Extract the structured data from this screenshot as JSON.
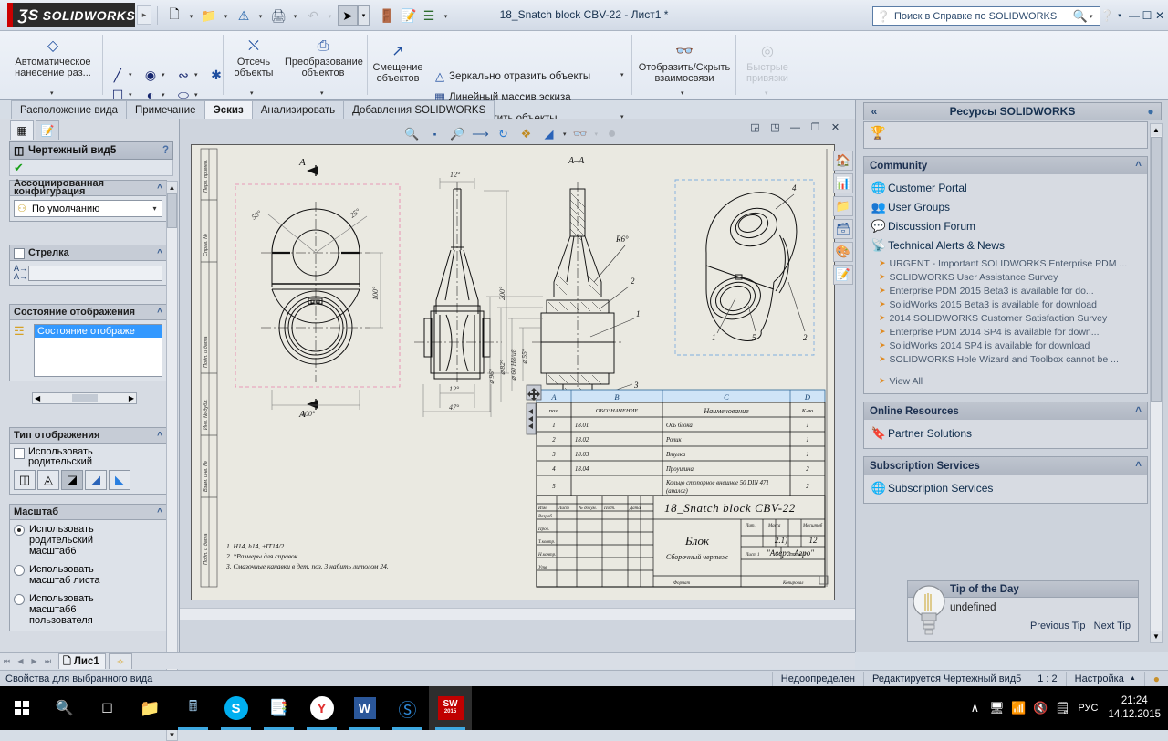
{
  "titlebar": {
    "logo_ds": "ƷS",
    "logo_text": "SOLIDWORKS",
    "document_title": "18_Snatch block CBV-22 - Лист1 *",
    "quick_access": [
      {
        "name": "new-document",
        "glyph": "🗋"
      },
      {
        "name": "open-document",
        "glyph": "📂"
      },
      {
        "name": "save-document",
        "glyph": "⚠"
      },
      {
        "name": "print-document",
        "glyph": "🖨"
      },
      {
        "name": "undo",
        "glyph": "↶"
      },
      {
        "name": "select",
        "glyph": "➤"
      },
      {
        "name": "rebuild",
        "glyph": "🚦"
      },
      {
        "name": "options-edit",
        "glyph": "📝"
      },
      {
        "name": "options",
        "glyph": "☰"
      }
    ],
    "help_search_placeholder": "Поиск в Справке по SOLIDWORKS",
    "window_buttons": [
      "❓",
      "➖",
      "❐",
      "✕"
    ]
  },
  "ribbon": {
    "auto_dimension": "Автоматическое\nнанесение раз...",
    "auto_dimension_l1": "Автоматическое",
    "auto_dimension_l2": "нанесение раз...",
    "trim_l1": "Отсечь",
    "trim_l2": "объекты",
    "convert_l1": "Преобразование",
    "convert_l2": "объектов",
    "offset_l1": "Смещение",
    "offset_l2": "объектов",
    "mirror": "Зеркально отразить объекты",
    "linear_pattern": "Линейный массив эскиза",
    "move_entities": "Переместить объекты",
    "display_relations_l1": "Отобразить/Скрыть",
    "display_relations_l2": "взаимосвязи",
    "quick_snaps_l1": "Быстрые",
    "quick_snaps_l2": "привязки"
  },
  "command_tabs": [
    {
      "label": "Расположение вида",
      "active": false
    },
    {
      "label": "Примечание",
      "active": false
    },
    {
      "label": "Эскиз",
      "active": true
    },
    {
      "label": "Анализировать",
      "active": false
    },
    {
      "label": "Добавления SOLIDWORKS",
      "active": false
    }
  ],
  "property_manager": {
    "title": "Чертежный вид5",
    "help_glyph": "?",
    "ok_glyph": "✔",
    "sections": {
      "config": {
        "title": "Ассоциированная конфигурация",
        "value": "По умолчанию"
      },
      "arrow": {
        "title": "Стрелка",
        "field_value": ""
      },
      "display_state": {
        "title": "Состояние отображения",
        "item": "Состояние отображе"
      },
      "display_type": {
        "title": "Тип отображения",
        "checkbox_l1": "Использовать",
        "checkbox_l2": "родительский",
        "buttons": [
          "wireframe",
          "hidden-lines-visible",
          "hidden-lines-removed",
          "shaded-with-edges",
          "shaded"
        ],
        "selected_index": 2
      },
      "scale": {
        "title": "Масштаб",
        "options": [
          {
            "label_l1": "Использовать",
            "label_l2": "родительский",
            "label_l3": "масштаб6",
            "selected": true
          },
          {
            "label_l1": "Использовать",
            "label_l2": "масштаб листа",
            "label_l3": "",
            "selected": false
          },
          {
            "label_l1": "Использовать",
            "label_l2": "масштаб6",
            "label_l3": "пользователя",
            "selected": false
          }
        ]
      }
    }
  },
  "drawing": {
    "view_toolbar": [
      {
        "name": "zoom-to-area-icon",
        "glyph": "🔍"
      },
      {
        "name": "zoom-to-fit-icon",
        "glyph": "⤡"
      },
      {
        "name": "zoom-in-out-icon",
        "glyph": "🔎"
      },
      {
        "name": "previous-view-icon",
        "glyph": "↶"
      },
      {
        "name": "rebuild-icon",
        "glyph": "↻"
      },
      {
        "name": "section-view-icon",
        "glyph": "❖"
      },
      {
        "name": "display-style-icon",
        "glyph": "❑"
      },
      {
        "name": "hide-show-icon",
        "glyph": "👓"
      },
      {
        "name": "appearance-icon",
        "glyph": "●"
      }
    ],
    "window_buttons": [
      "⬒",
      "⬓",
      "—",
      "❐",
      "✕"
    ],
    "section_label": "A–A",
    "section_mark": "A",
    "dimensions": {
      "d_50": "50°",
      "d_25": "25°",
      "d_100_v": "100°",
      "d_100_h": "100°",
      "d_12_top": "12°",
      "d_12_bot": "12°",
      "d_200": "200°",
      "d_47": "47°",
      "d_96": "⌀ 96°",
      "d_82": "⌀ 82°",
      "d_60": "⌀ 60 H8/u8",
      "d_55": "⌀ 55°",
      "d_r6": "R6°"
    },
    "balloons": [
      "1",
      "2",
      "3",
      "4",
      "5"
    ],
    "notes": [
      "1.  H14, h14, ±IT14/2.",
      "2.  *Размеры для справок.",
      "3.  Смазочные канавки в дет. поз. 3 набить литолом 24."
    ],
    "bom": {
      "column_letters": [
        "A",
        "B",
        "C",
        "D"
      ],
      "headers": [
        "поз.",
        "ОБОЗНАЧЕНИЕ",
        "Наименование",
        "К-во"
      ],
      "rows": [
        [
          "1",
          "18.01",
          "Ось блока",
          "1"
        ],
        [
          "2",
          "18.02",
          "Ролик",
          "1"
        ],
        [
          "3",
          "18.03",
          "Втулка",
          "1"
        ],
        [
          "4",
          "18.04",
          "Проушина",
          "2"
        ],
        [
          "5",
          "",
          "Кольцо стопорное внешнее 50 DIN 471 (аналог)",
          "2"
        ]
      ]
    },
    "title_block": {
      "drawing_number": "18_Snatch block CBV-22",
      "part_name": "Блок",
      "doc_type": "Сборочный чертеж",
      "company": "\"Аверс-Агро\"",
      "scale_label": "Масса",
      "scale_value": "2:1)",
      "mass_label": "Масштаб",
      "mass_value": "1:2",
      "lit_label": "Лит.",
      "sheet_label": "Лист 1",
      "sheets_label": "Листов 1",
      "rows": [
        "Разраб.",
        "Пров.",
        "Т.контр.",
        "Н.контр.",
        "Утв."
      ],
      "col_heads": [
        "Изм.",
        "Лист",
        "№ докум.",
        "Подп.",
        "Дата"
      ]
    }
  },
  "task_pane": {
    "header_title": "Ресурсы SOLIDWORKS",
    "collapse_glyph": "«",
    "pin_glyph": "📌",
    "icon_column": [
      {
        "name": "home-icon",
        "glyph": "🏠"
      },
      {
        "name": "design-library-icon",
        "glyph": "📊"
      },
      {
        "name": "file-explorer-icon",
        "glyph": "📁"
      },
      {
        "name": "view-palette-icon",
        "glyph": "🗂"
      },
      {
        "name": "appearances-icon",
        "glyph": "🎨"
      },
      {
        "name": "custom-properties-icon",
        "glyph": "📝"
      }
    ],
    "sections": [
      {
        "title": "Community",
        "links": [
          {
            "label": "Customer Portal",
            "icon": "customer-portal-icon",
            "glyph": "🌐"
          },
          {
            "label": "User Groups",
            "icon": "user-groups-icon",
            "glyph": "👥"
          },
          {
            "label": "Discussion Forum",
            "icon": "discussion-forum-icon",
            "glyph": "💬"
          },
          {
            "label": "Technical Alerts & News",
            "icon": "rss-icon",
            "glyph": "📡"
          }
        ],
        "news": [
          "URGENT - Important SOLIDWORKS Enterprise PDM ...",
          "SOLIDWORKS User Assistance Survey",
          "Enterprise PDM 2015 Beta3 is available for do...",
          "SolidWorks 2015 Beta3 is available for download",
          "2014 SOLIDWORKS Customer Satisfaction Survey",
          "Enterprise PDM 2014 SP4 is available for down...",
          "SolidWorks 2014 SP4 is available for download",
          "SOLIDWORKS Hole Wizard and Toolbox cannot be ..."
        ],
        "view_all": "View All"
      },
      {
        "title": "Online Resources",
        "links": [
          {
            "label": "Partner Solutions",
            "icon": "partner-solutions-icon",
            "glyph": "🔖"
          }
        ],
        "news": [],
        "view_all": ""
      },
      {
        "title": "Subscription Services",
        "links": [
          {
            "label": "Subscription Services",
            "icon": "subscription-services-icon",
            "glyph": "🌐"
          }
        ],
        "news": [],
        "view_all": ""
      }
    ],
    "tip_of_the_day": {
      "title": "Tip of the Day",
      "text": "undefined",
      "previous": "Previous Tip",
      "next": "Next Tip"
    }
  },
  "sheet_tabs": {
    "tabs": [
      {
        "label": "Лис1",
        "active": true
      }
    ],
    "add_label": "✨"
  },
  "status_bar": {
    "left": "Свойства для выбранного вида",
    "under_defined": "Недоопределен",
    "editing": "Редактируется Чертежный вид5",
    "scale": "1 : 2",
    "settings": "Настройка",
    "settings_arrow": "▲"
  },
  "taskbar": {
    "items": [
      {
        "name": "start-button",
        "glyph": "⊞",
        "state": "none"
      },
      {
        "name": "search-icon",
        "glyph": "🔍",
        "state": "none"
      },
      {
        "name": "task-view-icon",
        "glyph": "❐",
        "state": "none"
      },
      {
        "name": "file-explorer-icon",
        "glyph": "📁",
        "state": "none"
      },
      {
        "name": "calculator-icon",
        "glyph": "🖩",
        "state": "running"
      },
      {
        "name": "skype-icon",
        "glyph": "S",
        "state": "running"
      },
      {
        "name": "document-icon",
        "glyph": "📑",
        "state": "running"
      },
      {
        "name": "yandex-browser-icon",
        "glyph": "Y",
        "state": "running"
      },
      {
        "name": "word-icon",
        "glyph": "W",
        "state": "running"
      },
      {
        "name": "kompas-icon",
        "glyph": "Ⓚ",
        "state": "running"
      },
      {
        "name": "solidworks-icon",
        "glyph": "SW",
        "state": "active"
      }
    ],
    "tray": [
      {
        "name": "show-hidden-icons",
        "glyph": "∧"
      },
      {
        "name": "network-tray-icon",
        "glyph": "🖧"
      },
      {
        "name": "wifi-icon",
        "glyph": "📶"
      },
      {
        "name": "volume-icon",
        "glyph": "🔇"
      },
      {
        "name": "action-center-icon",
        "glyph": "🗒"
      },
      {
        "name": "language-indicator",
        "glyph": "РУС"
      }
    ],
    "clock_time": "21:24",
    "clock_date": "14.12.2015"
  },
  "colors": {
    "accent": "#3399ff",
    "brand_red": "#cc0000",
    "sheet_bg": "#eae9e1",
    "panel_bg": "#d6dbe3"
  }
}
